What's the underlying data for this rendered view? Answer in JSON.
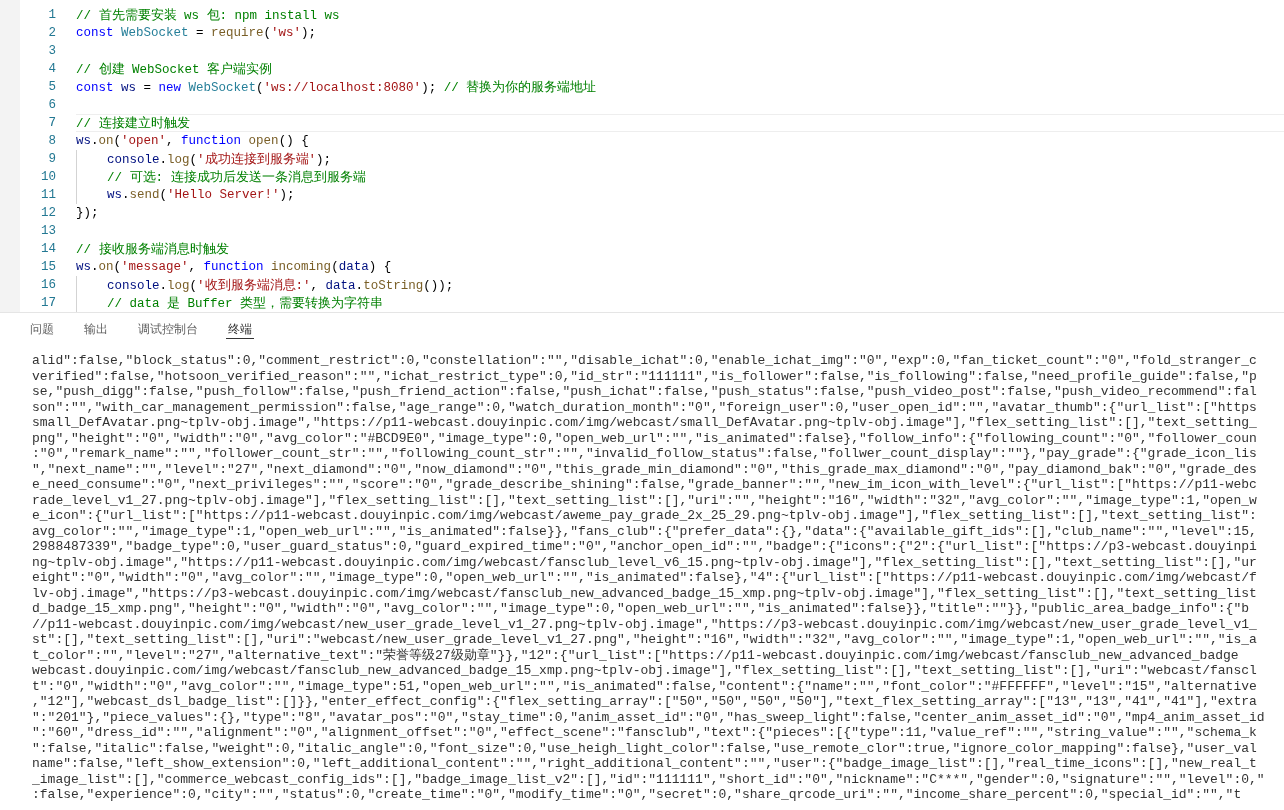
{
  "editor": {
    "lines": [
      {
        "number": "1",
        "current": false,
        "indented": false,
        "tokens": [
          {
            "kind": "comment",
            "text": "// 首先需要安装 ws 包: npm install ws"
          }
        ]
      },
      {
        "number": "2",
        "current": false,
        "indented": false,
        "tokens": [
          {
            "kind": "keyword",
            "text": "const"
          },
          {
            "kind": "class",
            "text": " WebSocket"
          },
          {
            "kind": "plain",
            "text": " = "
          },
          {
            "kind": "function",
            "text": "require"
          },
          {
            "kind": "plain",
            "text": "("
          },
          {
            "kind": "string",
            "text": "'ws'"
          },
          {
            "kind": "plain",
            "text": ");"
          }
        ]
      },
      {
        "number": "3",
        "current": false,
        "indented": false
      },
      {
        "number": "4",
        "current": false,
        "indented": false,
        "tokens": [
          {
            "kind": "comment",
            "text": "// 创建 WebSocket 客户端实例"
          }
        ]
      },
      {
        "number": "5",
        "current": false,
        "indented": false,
        "tokens": [
          {
            "kind": "keyword",
            "text": "const"
          },
          {
            "kind": "variable",
            "text": " ws"
          },
          {
            "kind": "plain",
            "text": " = "
          },
          {
            "kind": "keyword",
            "text": "new"
          },
          {
            "kind": "class",
            "text": " WebSocket"
          },
          {
            "kind": "plain",
            "text": "("
          },
          {
            "kind": "string",
            "text": "'ws://localhost:8080'"
          },
          {
            "kind": "plain",
            "text": "); "
          },
          {
            "kind": "comment",
            "text": "// 替换为你的服务端地址"
          }
        ]
      },
      {
        "number": "6",
        "current": false,
        "indented": false
      },
      {
        "number": "7",
        "current": true,
        "indented": false,
        "tokens": [
          {
            "kind": "comment",
            "text": "// 连接建立时触发"
          }
        ]
      },
      {
        "number": "8",
        "current": false,
        "indented": false,
        "tokens": [
          {
            "kind": "variable",
            "text": "ws"
          },
          {
            "kind": "plain",
            "text": "."
          },
          {
            "kind": "function",
            "text": "on"
          },
          {
            "kind": "plain",
            "text": "("
          },
          {
            "kind": "string",
            "text": "'open'"
          },
          {
            "kind": "plain",
            "text": ", "
          },
          {
            "kind": "keyword",
            "text": "function"
          },
          {
            "kind": "function",
            "text": " open"
          },
          {
            "kind": "plain",
            "text": "() {"
          }
        ]
      },
      {
        "number": "9",
        "current": false,
        "indented": true,
        "tokens": [
          {
            "kind": "variable",
            "text": "console"
          },
          {
            "kind": "plain",
            "text": "."
          },
          {
            "kind": "function",
            "text": "log"
          },
          {
            "kind": "plain",
            "text": "("
          },
          {
            "kind": "string",
            "text": "'成功连接到服务端'"
          },
          {
            "kind": "plain",
            "text": ");"
          }
        ]
      },
      {
        "number": "10",
        "current": false,
        "indented": true,
        "tokens": [
          {
            "kind": "comment",
            "text": "// 可选: 连接成功后发送一条消息到服务端"
          }
        ]
      },
      {
        "number": "11",
        "current": false,
        "indented": true,
        "tokens": [
          {
            "kind": "variable",
            "text": "ws"
          },
          {
            "kind": "plain",
            "text": "."
          },
          {
            "kind": "function",
            "text": "send"
          },
          {
            "kind": "plain",
            "text": "("
          },
          {
            "kind": "string",
            "text": "'Hello Server!'"
          },
          {
            "kind": "plain",
            "text": ");"
          }
        ]
      },
      {
        "number": "12",
        "current": false,
        "indented": false,
        "tokens": [
          {
            "kind": "plain",
            "text": "});"
          }
        ]
      },
      {
        "number": "13",
        "current": false,
        "indented": false
      },
      {
        "number": "14",
        "current": false,
        "indented": false,
        "tokens": [
          {
            "kind": "comment",
            "text": "// 接收服务端消息时触发"
          }
        ]
      },
      {
        "number": "15",
        "current": false,
        "indented": false,
        "tokens": [
          {
            "kind": "variable",
            "text": "ws"
          },
          {
            "kind": "plain",
            "text": "."
          },
          {
            "kind": "function",
            "text": "on"
          },
          {
            "kind": "plain",
            "text": "("
          },
          {
            "kind": "string",
            "text": "'message'"
          },
          {
            "kind": "plain",
            "text": ", "
          },
          {
            "kind": "keyword",
            "text": "function"
          },
          {
            "kind": "function",
            "text": " incoming"
          },
          {
            "kind": "plain",
            "text": "("
          },
          {
            "kind": "variable",
            "text": "data"
          },
          {
            "kind": "plain",
            "text": ") {"
          }
        ]
      },
      {
        "number": "16",
        "current": false,
        "indented": true,
        "tokens": [
          {
            "kind": "variable",
            "text": "console"
          },
          {
            "kind": "plain",
            "text": "."
          },
          {
            "kind": "function",
            "text": "log"
          },
          {
            "kind": "plain",
            "text": "("
          },
          {
            "kind": "string",
            "text": "'收到服务端消息:'"
          },
          {
            "kind": "plain",
            "text": ", "
          },
          {
            "kind": "variable",
            "text": "data"
          },
          {
            "kind": "plain",
            "text": "."
          },
          {
            "kind": "function",
            "text": "toString"
          },
          {
            "kind": "plain",
            "text": "());"
          }
        ]
      },
      {
        "number": "17",
        "current": false,
        "indented": true,
        "tokens": [
          {
            "kind": "comment",
            "text": "// data 是 Buffer 类型，需要转换为字符串"
          }
        ]
      }
    ]
  },
  "panel": {
    "tabs": [
      {
        "label": "问题",
        "selected": false
      },
      {
        "label": "输出",
        "selected": false
      },
      {
        "label": "调试控制台",
        "selected": false
      },
      {
        "label": "终端",
        "selected": true
      }
    ],
    "terminal_lines": [
      "alid\":false,\"block_status\":0,\"comment_restrict\":0,\"constellation\":\"\",\"disable_ichat\":0,\"enable_ichat_img\":\"0\",\"exp\":0,\"fan_ticket_count\":\"0\",\"fold_stranger_c",
      "verified\":false,\"hotsoon_verified_reason\":\"\",\"ichat_restrict_type\":0,\"id_str\":\"111111\",\"is_follower\":false,\"is_following\":false,\"need_profile_guide\":false,\"p",
      "se,\"push_digg\":false,\"push_follow\":false,\"push_friend_action\":false,\"push_ichat\":false,\"push_status\":false,\"push_video_post\":false,\"push_video_recommend\":fal",
      "son\":\"\",\"with_car_management_permission\":false,\"age_range\":0,\"watch_duration_month\":\"0\",\"foreign_user\":0,\"user_open_id\":\"\",\"avatar_thumb\":{\"url_list\":[\"https",
      "small_DefAvatar.png~tplv-obj.image\",\"https://p11-webcast.douyinpic.com/img/webcast/small_DefAvatar.png~tplv-obj.image\"],\"flex_setting_list\":[],\"text_setting_",
      "png\",\"height\":\"0\",\"width\":\"0\",\"avg_color\":\"#BCD9E0\",\"image_type\":0,\"open_web_url\":\"\",\"is_animated\":false},\"follow_info\":{\"following_count\":\"0\",\"follower_coun",
      ":\"0\",\"remark_name\":\"\",\"follower_count_str\":\"\",\"following_count_str\":\"\",\"invalid_follow_status\":false,\"follwer_count_display\":\"\"},\"pay_grade\":{\"grade_icon_lis",
      "\",\"next_name\":\"\",\"level\":\"27\",\"next_diamond\":\"0\",\"now_diamond\":\"0\",\"this_grade_min_diamond\":\"0\",\"this_grade_max_diamond\":\"0\",\"pay_diamond_bak\":\"0\",\"grade_des",
      "e_need_consume\":\"0\",\"next_privileges\":\"\",\"score\":\"0\",\"grade_describe_shining\":false,\"grade_banner\":\"\",\"new_im_icon_with_level\":{\"url_list\":[\"https://p11-webc",
      "rade_level_v1_27.png~tplv-obj.image\"],\"flex_setting_list\":[],\"text_setting_list\":[],\"uri\":\"\",\"height\":\"16\",\"width\":\"32\",\"avg_color\":\"\",\"image_type\":1,\"open_w",
      "e_icon\":{\"url_list\":[\"https://p11-webcast.douyinpic.com/img/webcast/aweme_pay_grade_2x_25_29.png~tplv-obj.image\"],\"flex_setting_list\":[],\"text_setting_list\":",
      "avg_color\":\"\",\"image_type\":1,\"open_web_url\":\"\",\"is_animated\":false}},\"fans_club\":{\"prefer_data\":{},\"data\":{\"available_gift_ids\":[],\"club_name\":\"\",\"level\":15,",
      "2988487339\",\"badge_type\":0,\"user_guard_status\":0,\"guard_expired_time\":\"0\",\"anchor_open_id\":\"\",\"badge\":{\"icons\":{\"2\":{\"url_list\":[\"https://p3-webcast.douyinpi",
      "ng~tplv-obj.image\",\"https://p11-webcast.douyinpic.com/img/webcast/fansclub_level_v6_15.png~tplv-obj.image\"],\"flex_setting_list\":[],\"text_setting_list\":[],\"ur",
      "eight\":\"0\",\"width\":\"0\",\"avg_color\":\"\",\"image_type\":0,\"open_web_url\":\"\",\"is_animated\":false},\"4\":{\"url_list\":[\"https://p11-webcast.douyinpic.com/img/webcast/f",
      "lv-obj.image\",\"https://p3-webcast.douyinpic.com/img/webcast/fansclub_new_advanced_badge_15_xmp.png~tplv-obj.image\"],\"flex_setting_list\":[],\"text_setting_list",
      "d_badge_15_xmp.png\",\"height\":\"0\",\"width\":\"0\",\"avg_color\":\"\",\"image_type\":0,\"open_web_url\":\"\",\"is_animated\":false}},\"title\":\"\"}},\"public_area_badge_info\":{\"b",
      "//p11-webcast.douyinpic.com/img/webcast/new_user_grade_level_v1_27.png~tplv-obj.image\",\"https://p3-webcast.douyinpic.com/img/webcast/new_user_grade_level_v1_",
      "st\":[],\"text_setting_list\":[],\"uri\":\"webcast/new_user_grade_level_v1_27.png\",\"height\":\"16\",\"width\":\"32\",\"avg_color\":\"\",\"image_type\":1,\"open_web_url\":\"\",\"is_a",
      "t_color\":\"\",\"level\":\"27\",\"alternative_text\":\"荣誉等级27级勋章\"}},\"12\":{\"url_list\":[\"https://p11-webcast.douyinpic.com/img/webcast/fansclub_new_advanced_badge",
      "webcast.douyinpic.com/img/webcast/fansclub_new_advanced_badge_15_xmp.png~tplv-obj.image\"],\"flex_setting_list\":[],\"text_setting_list\":[],\"uri\":\"webcast/fanscl",
      "t\":\"0\",\"width\":\"0\",\"avg_color\":\"\",\"image_type\":51,\"open_web_url\":\"\",\"is_animated\":false,\"content\":{\"name\":\"\",\"font_color\":\"#FFFFFF\",\"level\":\"15\",\"alternative",
      ",\"12\"],\"webcast_dsl_badge_list\":[]}},\"enter_effect_config\":{\"flex_setting_array\":[\"50\",\"50\",\"50\",\"50\"],\"text_flex_setting_array\":[\"13\",\"13\",\"41\",\"41\"],\"extra",
      "\":\"201\"},\"piece_values\":{},\"type\":\"8\",\"avatar_pos\":\"0\",\"stay_time\":0,\"anim_asset_id\":\"0\",\"has_sweep_light\":false,\"center_anim_asset_id\":\"0\",\"mp4_anim_asset_id",
      "\":\"60\",\"dress_id\":\"\",\"alignment\":\"0\",\"alignment_offset\":\"0\",\"effect_scene\":\"fansclub\",\"text\":{\"pieces\":[{\"type\":11,\"value_ref\":\"\",\"string_value\":\"\",\"schema_k",
      "\":false,\"italic\":false,\"weight\":0,\"italic_angle\":0,\"font_size\":0,\"use_heigh_light_color\":false,\"use_remote_clor\":true,\"ignore_color_mapping\":false},\"user_val",
      "name\":false,\"left_show_extension\":0,\"left_additional_content\":\"\",\"right_additional_content\":\"\",\"user\":{\"badge_image_list\":[],\"real_time_icons\":[],\"new_real_t",
      "_image_list\":[],\"commerce_webcast_config_ids\":[],\"badge_image_list_v2\":[],\"id\":\"111111\",\"short_id\":\"0\",\"nickname\":\"C***\",\"gender\":0,\"signature\":\"\",\"level\":0,\"",
      ":false,\"experience\":0,\"city\":\"\",\"status\":0,\"create_time\":\"0\",\"modify_time\":\"0\",\"secret\":0,\"share_qrcode_uri\":\"\",\"income_share_percent\":0,\"special_id\":\"\",\"t"
    ]
  }
}
